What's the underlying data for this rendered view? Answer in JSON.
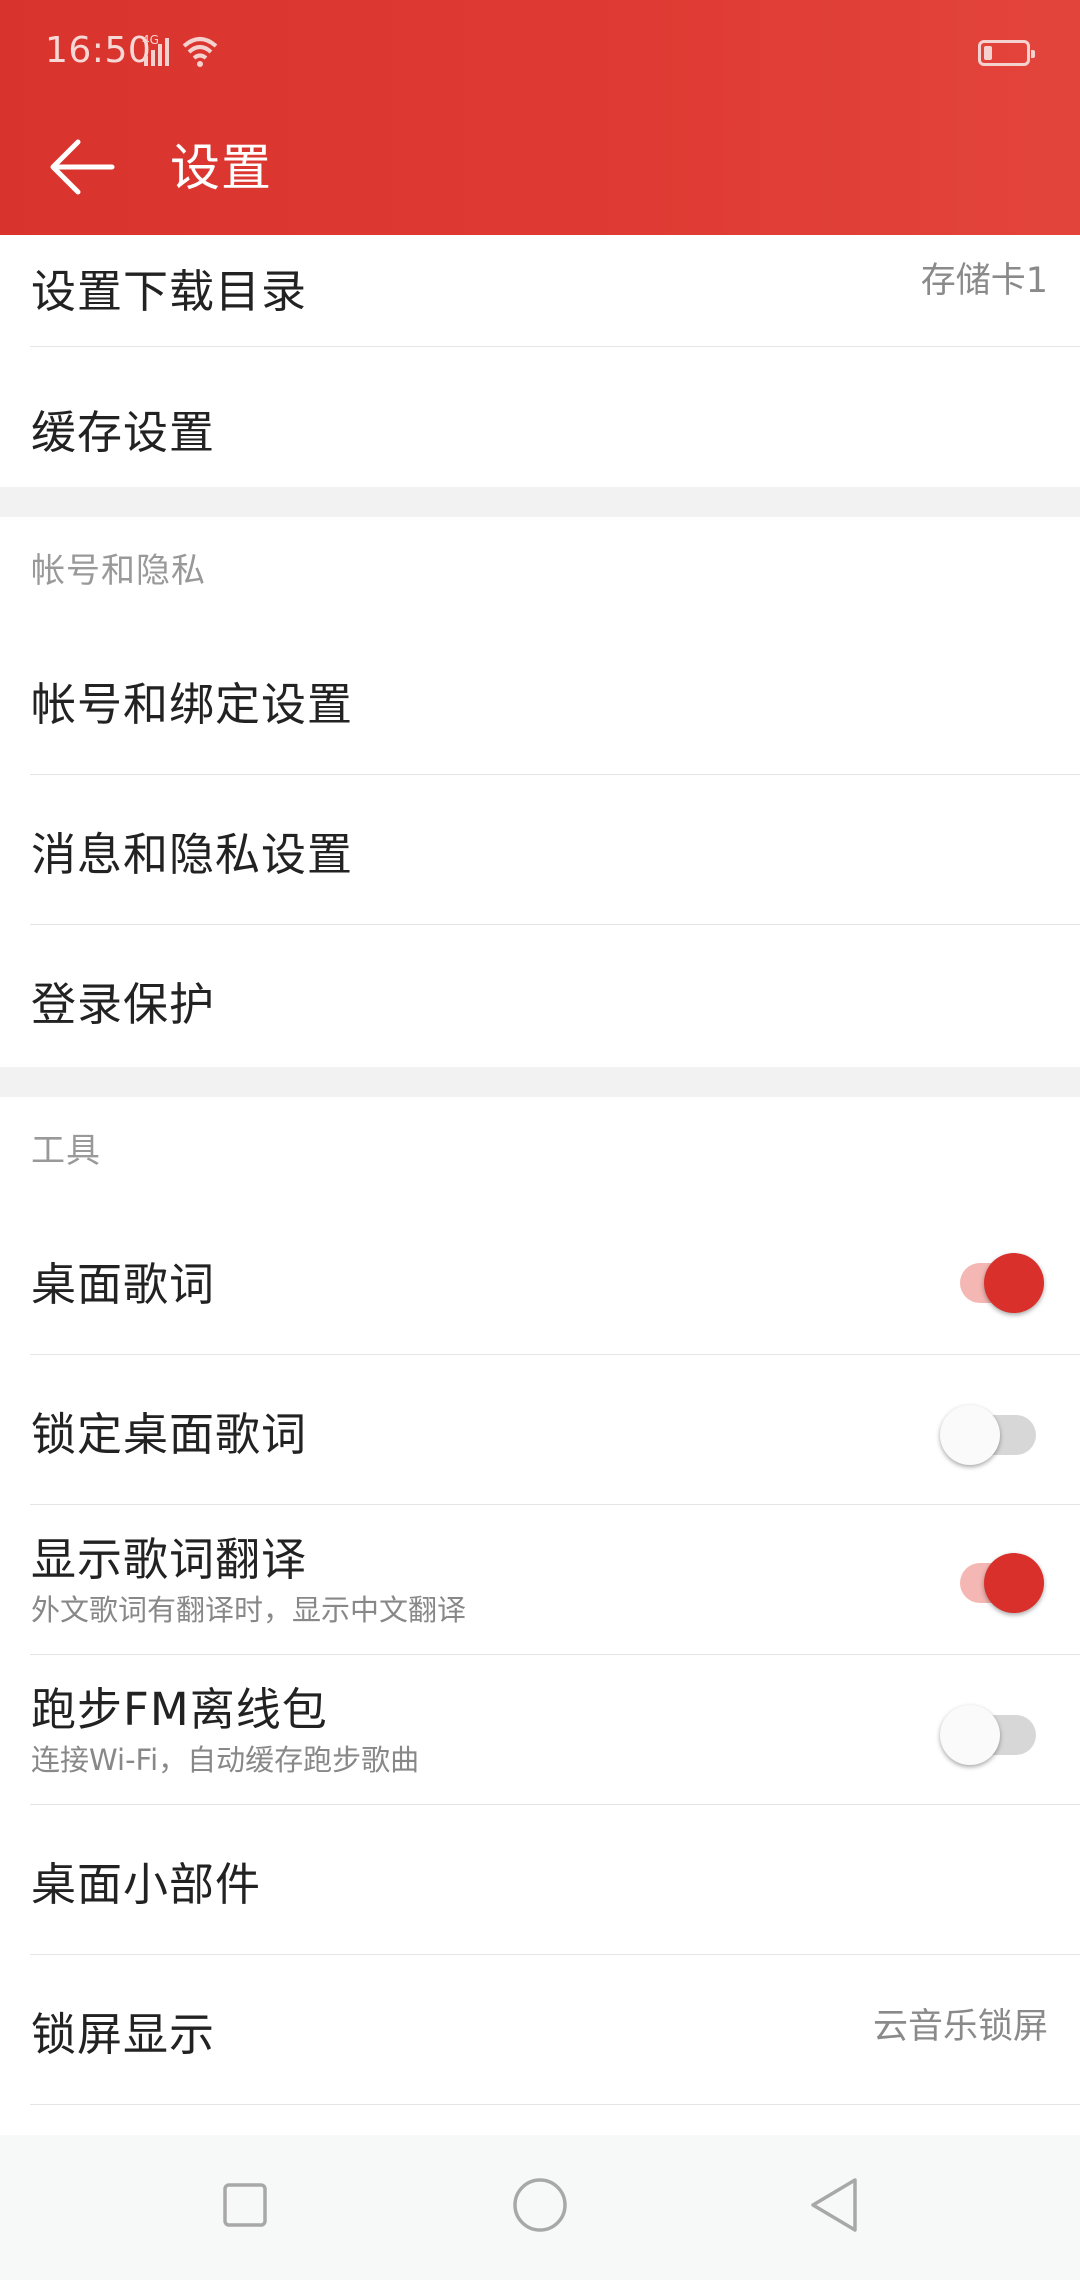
{
  "status_bar": {
    "time": "16:50",
    "network": "4G",
    "battery_level": 0.2
  },
  "toolbar": {
    "title": "设置",
    "back_icon": "arrow-left-icon"
  },
  "colors": {
    "accent": "#d9302b",
    "header_bg": "#df3b34",
    "switch_on_track": "#f4b7b3",
    "section_bg": "#f2f2f2"
  },
  "settings": {
    "download_dir": {
      "label": "设置下载目录",
      "value": "存储卡1"
    },
    "cache": {
      "label": "缓存设置"
    },
    "account_section": {
      "header": "帐号和隐私",
      "account_binding": {
        "label": "帐号和绑定设置"
      },
      "message_privacy": {
        "label": "消息和隐私设置"
      },
      "login_protect": {
        "label": "登录保护"
      }
    },
    "tools_section": {
      "header": "工具",
      "desktop_lyrics": {
        "label": "桌面歌词",
        "enabled": true
      },
      "lock_desktop_lyrics": {
        "label": "锁定桌面歌词",
        "enabled": false
      },
      "show_translation": {
        "label": "显示歌词翻译",
        "description": "外文歌词有翻译时，显示中文翻译",
        "enabled": true
      },
      "running_fm": {
        "label": "跑步FM离线包",
        "description": "连接Wi-Fi，自动缓存跑步歌曲",
        "enabled": false
      },
      "desktop_widget": {
        "label": "桌面小部件"
      },
      "lock_screen": {
        "label": "锁屏显示",
        "value": "云音乐锁屏"
      }
    }
  },
  "nav_bar": {
    "recents_icon": "square-icon",
    "home_icon": "circle-icon",
    "back_icon": "triangle-back-icon"
  }
}
